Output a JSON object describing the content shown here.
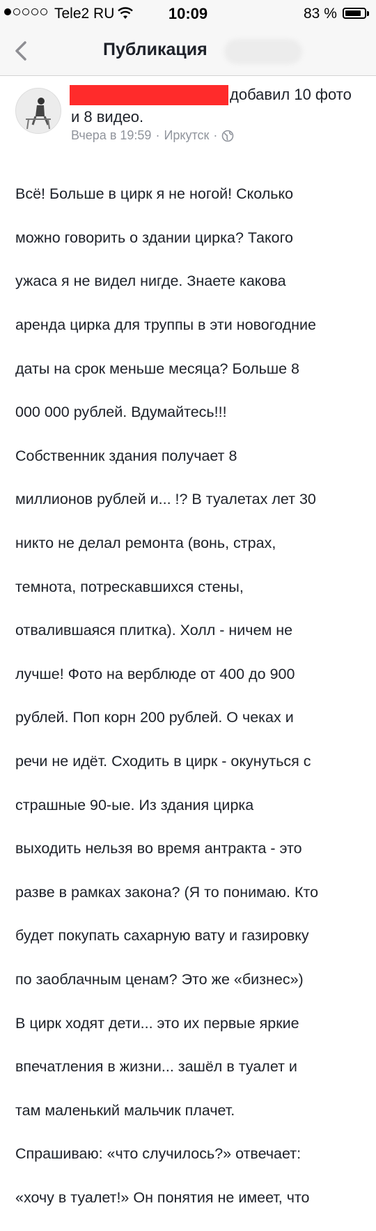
{
  "status_bar": {
    "carrier": "Tele2 RU",
    "time": "10:09",
    "battery": "83 %",
    "battery_level": 0.83,
    "signal_bars_filled": 1,
    "signal_bars_total": 5
  },
  "nav": {
    "back_icon": "chevron-left-icon",
    "title": "Публикация"
  },
  "post": {
    "action": "добавил 10 фото и 8 видео.",
    "timestamp": "Вчера в 19:59",
    "separator": "·",
    "location": "Иркутск",
    "privacy_icon": "globe-icon",
    "redaction_color": "#ff2b2b",
    "body_lines": [
      "Всё! Больше в цирк я не ногой! Сколько",
      "можно говорить о здании цирка? Такого",
      "ужаса я не видел нигде. Знаете какова",
      "аренда цирка для труппы в эти новогодние",
      "даты на срок меньше месяца? Больше 8",
      "000 000 рублей. Вдумайтесь!!!",
      "Собственник здания получает 8",
      "миллионов рублей и... !? В туалетах лет 30",
      "никто не делал ремонта (вонь, страх,",
      "темнота, потрескавшихся стены,",
      "отвалившаяся плитка). Холл - ничем не",
      "лучше! Фото на верблюде от 400 до 900",
      "рублей. Поп корн 200 рублей. О чеках и",
      "речи не идёт. Сходить в цирк - окунуться с",
      "страшные 90-ые. Из здания цирка",
      "выходить нельзя во время антракта - это",
      "разве в рамках закона? (Я то понимаю. Кто",
      "будет покупать сахарную вату и газировку",
      "по заоблачным ценам? Это же «бизнес»)",
      "В цирк ходят дети... это их первые яркие",
      "впечатления в жизни... зашёл в туалет и",
      "там маленький мальчик плачет.",
      "Спрашиваю: «что случилось?» отвечает:",
      "«хочу в туалет!» Он понятия не имеет, что"
    ]
  }
}
